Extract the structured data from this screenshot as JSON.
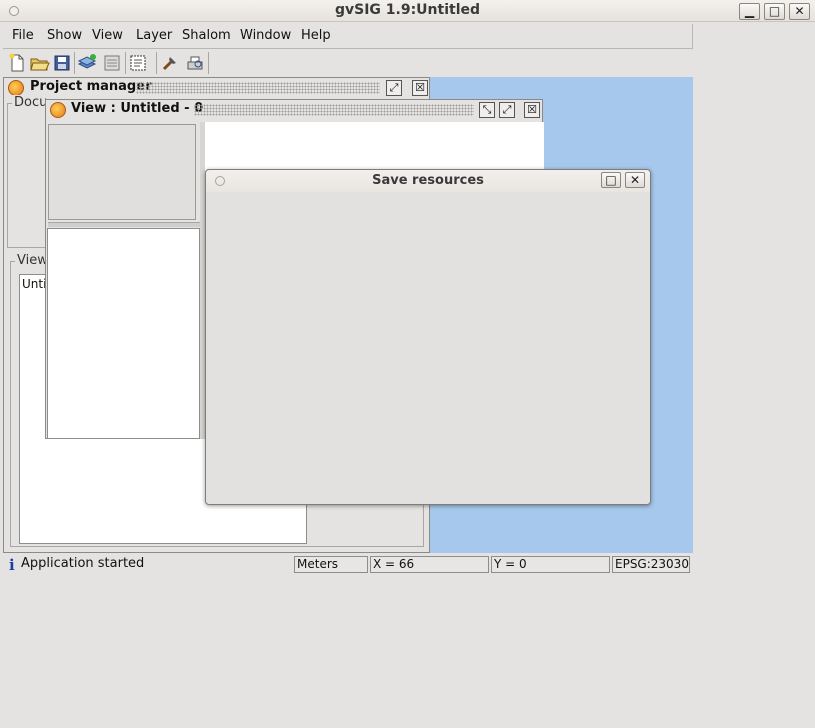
{
  "window": {
    "title": "gvSIG 1.9:Untitled",
    "controls": [
      "minimize-icon",
      "maximize-icon",
      "close-icon"
    ]
  },
  "menubar": {
    "items": [
      "File",
      "Show",
      "View",
      "Layer",
      "Shalom",
      "Window",
      "Help"
    ]
  },
  "toolbar": {
    "buttons": [
      "new-project-icon",
      "open-project-icon",
      "save-project-icon",
      "add-layer-icon",
      "layer-properties-icon",
      "select-area-icon",
      "tools-icon",
      "print-preview-icon"
    ]
  },
  "project_manager": {
    "title": "Project manager",
    "documents_label": "Docu",
    "views_label": "View",
    "views_list_item": "Untit"
  },
  "view_window": {
    "title": "View : Untitled - 0"
  },
  "dialog": {
    "title": "Save resources"
  },
  "statusbar": {
    "message": "Application started",
    "units": "Meters",
    "x": "X = 66",
    "y": "Y = 0",
    "crs": "EPSG:23030"
  },
  "colors": {
    "desktop": "#a6c8ed",
    "window_bg": "#e4e3e2"
  }
}
